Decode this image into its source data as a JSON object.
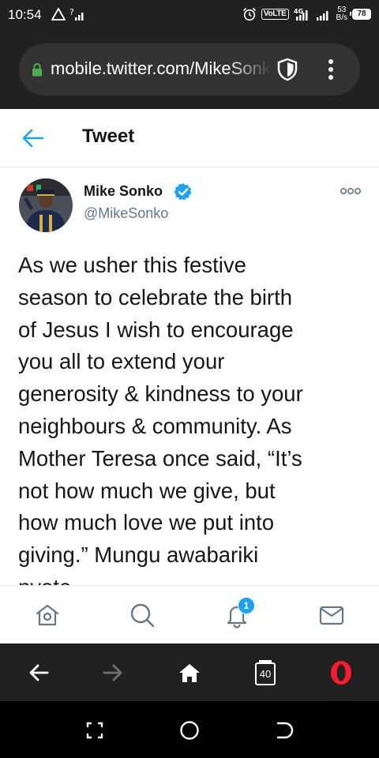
{
  "status_bar": {
    "time": "10:54",
    "network_badge": "VoLTE",
    "network_type": "4G",
    "speed_value": "53",
    "speed_unit": "B/s",
    "battery": "78"
  },
  "browser": {
    "url": "mobile.twitter.com/MikeSonko",
    "accent_color": "#4caf50"
  },
  "tweet_page": {
    "header_title": "Tweet",
    "author_name": "Mike Sonko",
    "author_handle": "@MikeSonko",
    "verified": true,
    "tweet_lines": [
      "As we usher this festive",
      "season to celebrate the birth",
      "of Jesus I wish to encourage",
      "you all to extend your",
      "generosity & kindness to your",
      "neighbours & community. As",
      "Mother Teresa once said, “It’s",
      "not how much we give, but",
      "how much love we put into",
      "giving.” Mungu awabariki",
      "nyote"
    ],
    "accent_color": "#1da1f2"
  },
  "twitter_nav": {
    "items": [
      "home-icon",
      "search-icon",
      "notifications-icon",
      "messages-icon"
    ],
    "notification_count": "1"
  },
  "opera_nav": {
    "items": [
      "back-icon",
      "forward-icon",
      "home-icon",
      "tabs-icon",
      "opera-menu-icon"
    ],
    "tab_count": "40",
    "brand_color": "#ff1b2d"
  },
  "android_nav": {
    "items": [
      "recents-icon",
      "home-circle-icon",
      "back-icon"
    ]
  }
}
